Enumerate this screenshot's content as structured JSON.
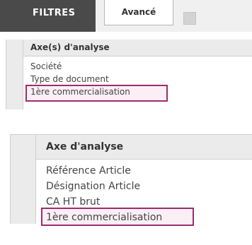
{
  "panel1": {
    "tabs": {
      "filtres": "FILTRES",
      "avance": "Avancé"
    },
    "grid": {
      "header": "Axe(s) d'analyse",
      "items": [
        "Société",
        "Type de document",
        "1ère commercialisation"
      ],
      "highlighted_index": 2
    }
  },
  "panel2": {
    "grid": {
      "header": "Axe d'analyse",
      "items": [
        "Référence Article",
        "Désignation Article",
        "CA HT brut",
        "1ère commercialisation"
      ],
      "highlighted_index": 3
    }
  },
  "colors": {
    "active_tab_bg": "#4a4a4a",
    "highlight_border": "#9c2d6e",
    "highlight_fill": "#fbeff5"
  }
}
